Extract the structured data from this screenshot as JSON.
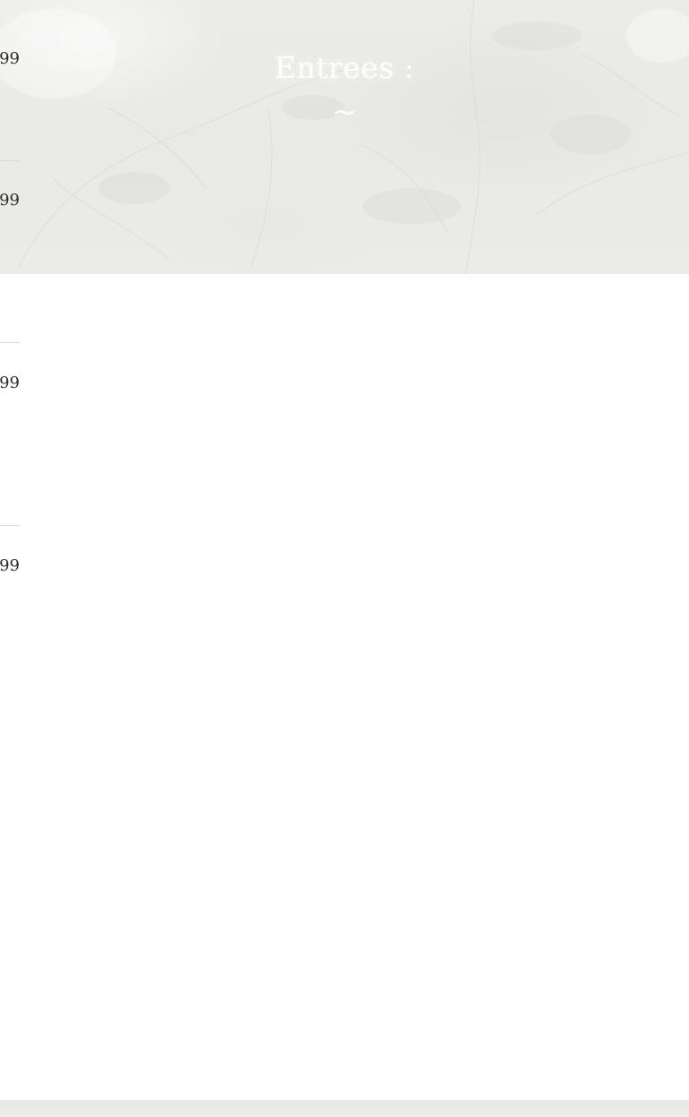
{
  "section": {
    "title": "Entrees :",
    "ornament": "~"
  },
  "menu": {
    "items": [
      {
        "price": "99"
      },
      {
        "price": "99"
      },
      {
        "price": "99"
      },
      {
        "price": "99"
      }
    ]
  },
  "colors": {
    "hero_overlay": "#ebebe8",
    "title_text": "#ffffff",
    "price_text": "#2b2b2b",
    "divider": "#d9d9d9"
  }
}
